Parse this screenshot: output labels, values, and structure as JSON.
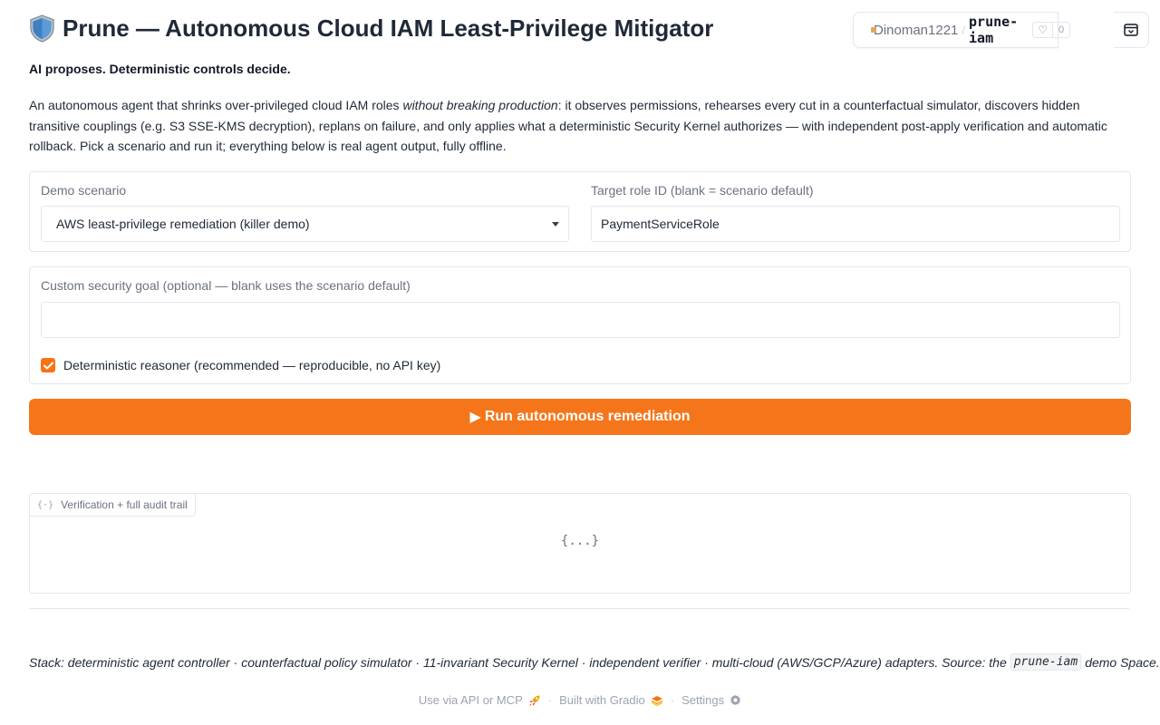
{
  "space": {
    "owner": "Dinoman1221",
    "repo": "prune-iam",
    "likes": "0"
  },
  "header": {
    "title": "Prune — Autonomous Cloud IAM Least-Privilege Mitigator",
    "tagline": "AI proposes. Deterministic controls decide.",
    "intro_before": "An autonomous agent that shrinks over-privileged cloud IAM roles ",
    "intro_em": "without breaking production",
    "intro_after": ": it observes permissions, rehearses every cut in a counterfactual simulator, discovers hidden transitive couplings (e.g. S3 SSE-KMS decryption), replans on failure, and only applies what a deterministic Security Kernel authorizes — with independent post-apply verification and automatic rollback. Pick a scenario and run it; everything below is real agent output, fully offline."
  },
  "form": {
    "scenario_label": "Demo scenario",
    "scenario_value": "AWS least-privilege remediation (killer demo)",
    "role_label": "Target role ID (blank = scenario default)",
    "role_value": "PaymentServiceRole",
    "goal_label": "Custom security goal (optional — blank uses the scenario default)",
    "goal_value": "",
    "checkbox_label": "Deterministic reasoner (recommended — reproducible, no API key)",
    "checkbox_checked": true,
    "run_label": "Run autonomous remediation"
  },
  "output": {
    "label": "Verification + full audit trail",
    "empty_text": "{...}"
  },
  "stack": {
    "before": "Stack: deterministic agent controller · counterfactual policy simulator · 11-invariant Security Kernel · independent verifier · multi-cloud (AWS/GCP/Azure) adapters. Source: the",
    "code": "prune-iam",
    "after": "demo Space."
  },
  "footer": {
    "api": "Use via API or MCP",
    "gradio": "Built with Gradio",
    "settings": "Settings",
    "separator": "·"
  },
  "colors": {
    "accent": "#f5761a",
    "border": "#e5e7eb",
    "muted": "#6b7280"
  }
}
